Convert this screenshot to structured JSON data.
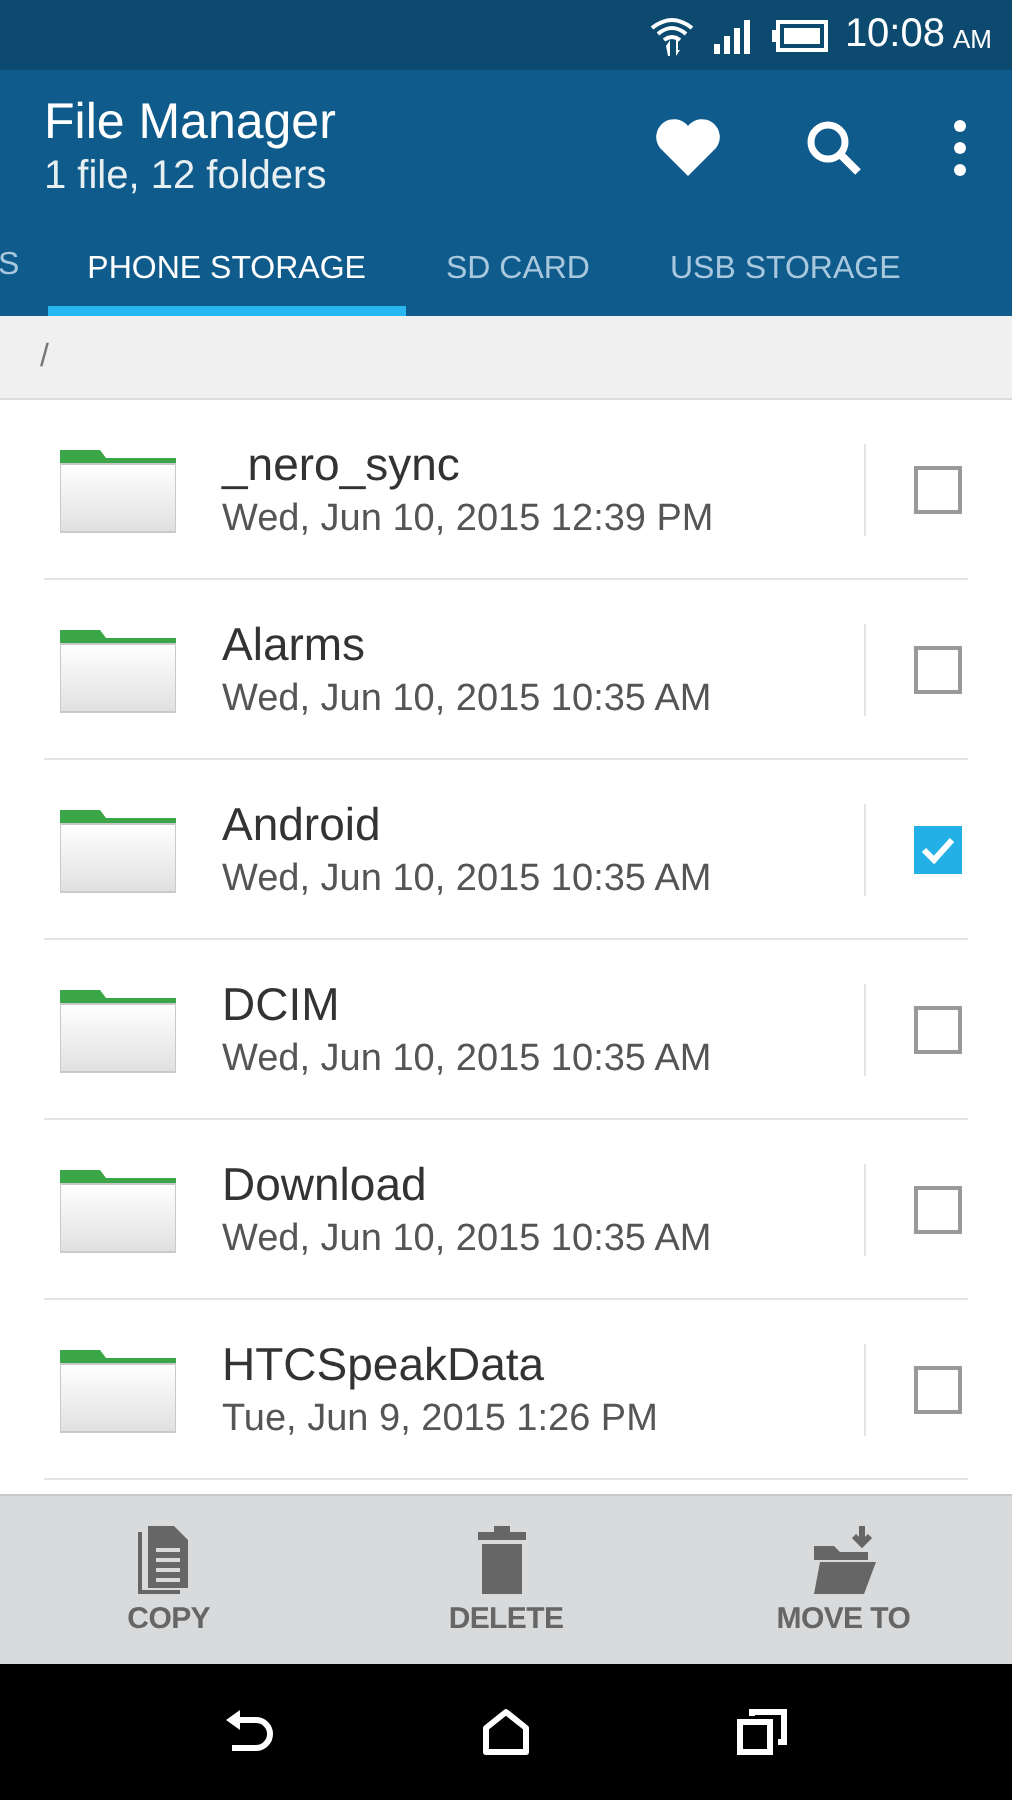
{
  "status_bar": {
    "time": "10:08",
    "meridiem": "AM"
  },
  "app_bar": {
    "title": "File Manager",
    "subtitle": "1 file, 12 folders"
  },
  "tabs": [
    {
      "label": "S",
      "selected": false
    },
    {
      "label": "PHONE STORAGE",
      "selected": true
    },
    {
      "label": "SD CARD",
      "selected": false
    },
    {
      "label": "USB STORAGE",
      "selected": false
    }
  ],
  "path": "/",
  "files": [
    {
      "name": "_nero_sync",
      "modified": "Wed, Jun 10, 2015 12:39 PM",
      "checked": false
    },
    {
      "name": "Alarms",
      "modified": "Wed, Jun 10, 2015 10:35 AM",
      "checked": false
    },
    {
      "name": "Android",
      "modified": "Wed, Jun 10, 2015 10:35 AM",
      "checked": true
    },
    {
      "name": "DCIM",
      "modified": "Wed, Jun 10, 2015 10:35 AM",
      "checked": false
    },
    {
      "name": "Download",
      "modified": "Wed, Jun 10, 2015 10:35 AM",
      "checked": false
    },
    {
      "name": "HTCSpeakData",
      "modified": "Tue, Jun 9, 2015 1:26 PM",
      "checked": false
    }
  ],
  "actions": [
    {
      "kind": "copy",
      "label": "COPY"
    },
    {
      "kind": "delete",
      "label": "DELETE"
    },
    {
      "kind": "move",
      "label": "MOVE TO"
    }
  ]
}
